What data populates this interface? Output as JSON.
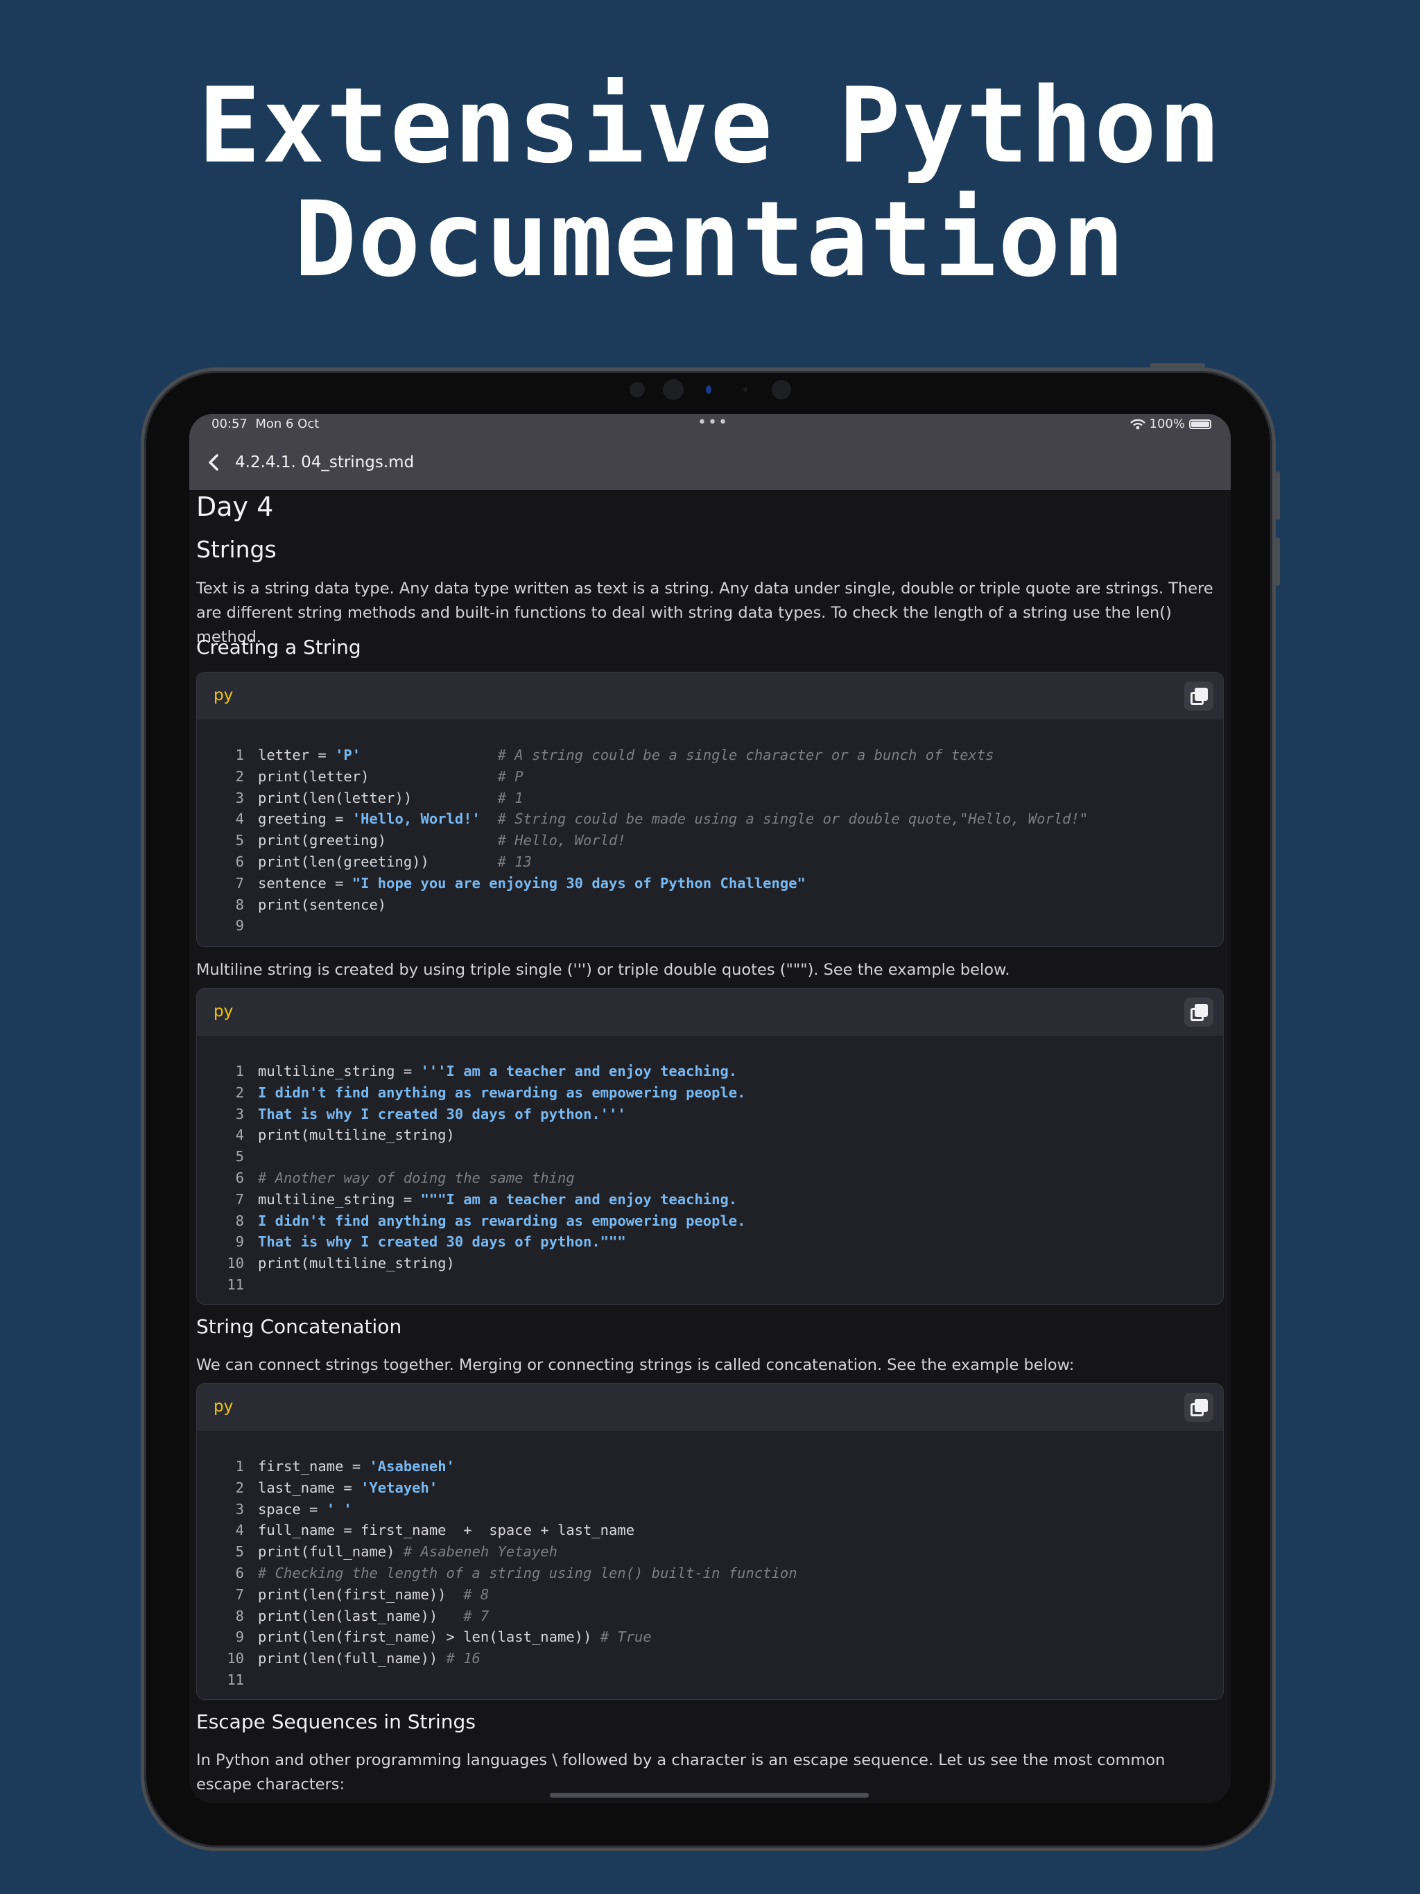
{
  "hero": {
    "line1": "Extensive Python",
    "line2": "Documentation"
  },
  "status": {
    "time": "00:57",
    "date": "Mon 6 Oct",
    "dots": "•••",
    "wifi": "wifi-icon",
    "battery_pct": "100%"
  },
  "nav": {
    "back_icon": "chevron-left-icon",
    "title": "4.2.4.1. 04_strings.md"
  },
  "doc": {
    "h_day": "Day 4",
    "h_strings": "Strings",
    "p_intro": "Text is a string data type. Any data type written as text is a string. Any data under single, double or triple quote are strings. There are different string methods and built-in functions to deal with string data types. To check the length of a string use the len() method.",
    "h_create": "Creating a String",
    "p_multiline": "Multiline string is created by using triple single (''') or triple double quotes (\"\"\"). See the example below.",
    "h_concat": "String Concatenation",
    "p_concat": "We can connect strings together. Merging or connecting strings is called concatenation. See the example below:",
    "h_escape": "Escape Sequences in Strings",
    "p_escape": "In Python and other programming languages \\ followed by a character is an escape sequence. Let us see the most common escape characters:"
  },
  "code_blocks": [
    {
      "lang": "py",
      "lines": [
        {
          "n": "1",
          "parts": [
            [
              "id",
              "letter = "
            ],
            [
              "str",
              "'P'"
            ],
            [
              "id",
              "                "
            ],
            [
              "com",
              "# A string could be a single character or a bunch of texts"
            ]
          ]
        },
        {
          "n": "2",
          "parts": [
            [
              "id",
              "print(letter)               "
            ],
            [
              "com",
              "# P"
            ]
          ]
        },
        {
          "n": "3",
          "parts": [
            [
              "id",
              "print(len(letter))          "
            ],
            [
              "com",
              "# 1"
            ]
          ]
        },
        {
          "n": "4",
          "parts": [
            [
              "id",
              "greeting = "
            ],
            [
              "str",
              "'Hello, World!'"
            ],
            [
              "id",
              "  "
            ],
            [
              "com",
              "# String could be made using a single or double quote,\"Hello, World!\""
            ]
          ]
        },
        {
          "n": "5",
          "parts": [
            [
              "id",
              "print(greeting)             "
            ],
            [
              "com",
              "# Hello, World!"
            ]
          ]
        },
        {
          "n": "6",
          "parts": [
            [
              "id",
              "print(len(greeting))        "
            ],
            [
              "com",
              "# 13"
            ]
          ]
        },
        {
          "n": "7",
          "parts": [
            [
              "id",
              "sentence = "
            ],
            [
              "str",
              "\"I hope you are enjoying 30 days of Python Challenge\""
            ]
          ]
        },
        {
          "n": "8",
          "parts": [
            [
              "id",
              "print(sentence)"
            ]
          ]
        },
        {
          "n": "9",
          "parts": []
        }
      ]
    },
    {
      "lang": "py",
      "lines": [
        {
          "n": "1",
          "parts": [
            [
              "id",
              "multiline_string = "
            ],
            [
              "str",
              "'''I am a teacher and enjoy teaching."
            ]
          ]
        },
        {
          "n": "2",
          "parts": [
            [
              "str",
              "I didn't find anything as rewarding as empowering people."
            ]
          ]
        },
        {
          "n": "3",
          "parts": [
            [
              "str",
              "That is why I created 30 days of python.'''"
            ]
          ]
        },
        {
          "n": "4",
          "parts": [
            [
              "id",
              "print(multiline_string)"
            ]
          ]
        },
        {
          "n": "5",
          "parts": []
        },
        {
          "n": "6",
          "parts": [
            [
              "com",
              "# Another way of doing the same thing"
            ]
          ]
        },
        {
          "n": "7",
          "parts": [
            [
              "id",
              "multiline_string = "
            ],
            [
              "str",
              "\"\"\"I am a teacher and enjoy teaching."
            ]
          ]
        },
        {
          "n": "8",
          "parts": [
            [
              "str",
              "I didn't find anything as rewarding as empowering people."
            ]
          ]
        },
        {
          "n": "9",
          "parts": [
            [
              "str",
              "That is why I created 30 days of python.\"\"\""
            ]
          ]
        },
        {
          "n": "10",
          "parts": [
            [
              "id",
              "print(multiline_string)"
            ]
          ]
        },
        {
          "n": "11",
          "parts": []
        }
      ]
    },
    {
      "lang": "py",
      "lines": [
        {
          "n": "1",
          "parts": [
            [
              "id",
              "first_name = "
            ],
            [
              "str",
              "'Asabeneh'"
            ]
          ]
        },
        {
          "n": "2",
          "parts": [
            [
              "id",
              "last_name = "
            ],
            [
              "str",
              "'Yetayeh'"
            ]
          ]
        },
        {
          "n": "3",
          "parts": [
            [
              "id",
              "space = "
            ],
            [
              "str",
              "' '"
            ]
          ]
        },
        {
          "n": "4",
          "parts": [
            [
              "id",
              "full_name = first_name  +  space + last_name"
            ]
          ]
        },
        {
          "n": "5",
          "parts": [
            [
              "id",
              "print(full_name) "
            ],
            [
              "com",
              "# Asabeneh Yetayeh"
            ]
          ]
        },
        {
          "n": "6",
          "parts": [
            [
              "com",
              "# Checking the length of a string using len() built-in function"
            ]
          ]
        },
        {
          "n": "7",
          "parts": [
            [
              "id",
              "print(len(first_name))  "
            ],
            [
              "com",
              "# 8"
            ]
          ]
        },
        {
          "n": "8",
          "parts": [
            [
              "id",
              "print(len(last_name))   "
            ],
            [
              "com",
              "# 7"
            ]
          ]
        },
        {
          "n": "9",
          "parts": [
            [
              "id",
              "print(len(first_name) > len(last_name)) "
            ],
            [
              "com",
              "# True"
            ]
          ]
        },
        {
          "n": "10",
          "parts": [
            [
              "id",
              "print(len(full_name)) "
            ],
            [
              "com",
              "# 16"
            ]
          ]
        },
        {
          "n": "11",
          "parts": []
        }
      ]
    }
  ],
  "icons": {
    "copy": "copy-icon"
  },
  "colors": {
    "background": "#1c3b5a",
    "lang_label": "#f1c40f",
    "string": "#78b9f2",
    "comment": "#7d7d86"
  }
}
